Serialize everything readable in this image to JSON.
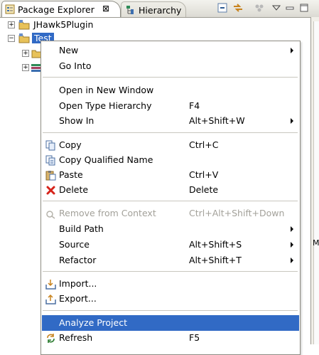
{
  "tabs": {
    "package_explorer": "Package Explorer",
    "close_glyph": "⊠",
    "hierarchy": "Hierarchy"
  },
  "tree": {
    "items": [
      {
        "label": "JHawk5Plugin"
      },
      {
        "label": "Test"
      }
    ]
  },
  "menu": {
    "new": "New",
    "go_into": "Go Into",
    "open_new_window": "Open in New Window",
    "open_type_hierarchy": "Open Type Hierarchy",
    "open_type_hierarchy_key": "F4",
    "show_in": "Show In",
    "show_in_key": "Alt+Shift+W",
    "copy": "Copy",
    "copy_key": "Ctrl+C",
    "copy_qualified": "Copy Qualified Name",
    "paste": "Paste",
    "paste_key": "Ctrl+V",
    "delete": "Delete",
    "delete_key": "Delete",
    "remove_context": "Remove from Context",
    "remove_context_key": "Ctrl+Alt+Shift+Down",
    "build_path": "Build Path",
    "source": "Source",
    "source_key": "Alt+Shift+S",
    "refactor": "Refactor",
    "refactor_key": "Alt+Shift+T",
    "import": "Import...",
    "export": "Export...",
    "analyze": "Analyze Project",
    "refresh": "Refresh",
    "refresh_key": "F5"
  },
  "side": {
    "partial_label": "M"
  },
  "colors": {
    "selection": "#316ac5",
    "menu_border": "#8d8b82",
    "delete_icon": "#d6231a"
  }
}
